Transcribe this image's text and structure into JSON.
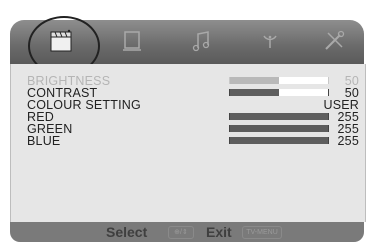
{
  "tabs": [
    {
      "icon": "clapperboard-picture-icon",
      "active": true
    },
    {
      "icon": "screen-icon",
      "active": false
    },
    {
      "icon": "music-notes-icon",
      "active": false
    },
    {
      "icon": "satellite-dish-icon",
      "active": false
    },
    {
      "icon": "wrench-tools-icon",
      "active": false
    }
  ],
  "menu": {
    "items": [
      {
        "label": "BRIGHTNESS",
        "value": "50",
        "level": 0.5,
        "dim": true
      },
      {
        "label": "CONTRAST",
        "value": "50",
        "level": 0.5,
        "dim": false
      },
      {
        "label": "COLOUR SETTING",
        "value": "USER"
      },
      {
        "label": "RED",
        "value": "255",
        "level": 1.0
      },
      {
        "label": "GREEN",
        "value": "255",
        "level": 1.0
      },
      {
        "label": "BLUE",
        "value": "255",
        "level": 1.0
      }
    ]
  },
  "footer": {
    "select_label": "Select",
    "select_key": "⊕/⇕",
    "exit_label": "Exit",
    "exit_key": "TV-MENU"
  },
  "colors": {
    "tabbar": "#6e6e6e",
    "panel": "#e6e6e6",
    "footer": "#7a7a7a",
    "bar_fill": "#5e5e5e"
  }
}
